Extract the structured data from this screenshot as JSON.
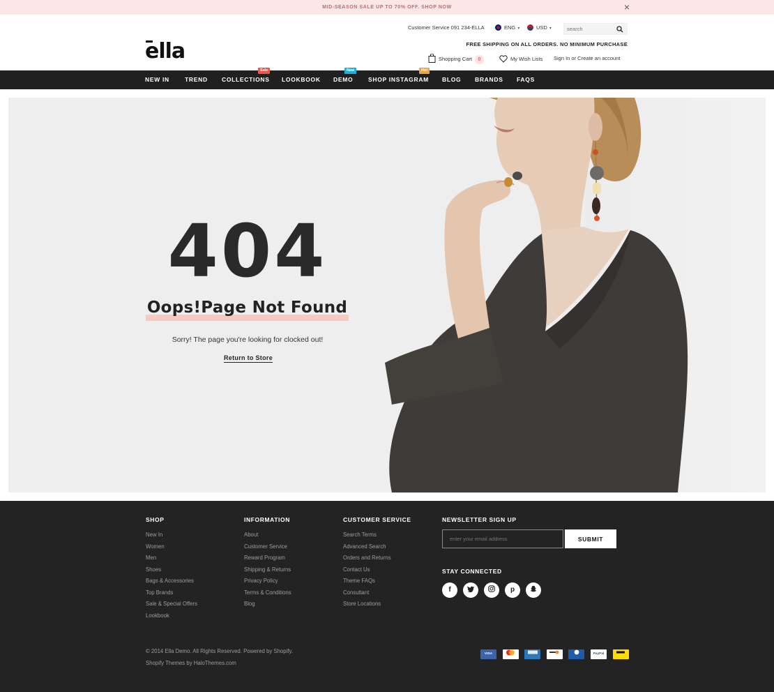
{
  "announcement": {
    "text": "MID-SEASON SALE UP TO 70% OFF. SHOP NOW"
  },
  "header": {
    "logo": "ella",
    "customer_service": "Customer Service 091 234-ELLA",
    "language": "ENG",
    "currency": "USD",
    "search_placeholder": "search",
    "free_shipping": "FREE SHIPPING ON ALL ORDERS. NO MINIMUM PURCHASE",
    "cart_label": "Shopping Cart",
    "cart_count": "0",
    "wishlist_label": "My Wish Lists",
    "signin_label": "Sign In or Create an account"
  },
  "nav": {
    "items": [
      {
        "label": "NEW IN"
      },
      {
        "label": "TREND"
      },
      {
        "label": "COLLECTIONS",
        "badge": "Sale",
        "badge_color": "#e9564a"
      },
      {
        "label": "LOOKBOOK"
      },
      {
        "label": "DEMO",
        "badge": "New",
        "badge_color": "#1fb0d8"
      },
      {
        "label": "SHOP INSTAGRAM",
        "badge": "Hot",
        "badge_color": "#f1a43a"
      },
      {
        "label": "BLOG"
      },
      {
        "label": "BRANDS"
      },
      {
        "label": "FAQS"
      }
    ]
  },
  "hero": {
    "code": "404",
    "title": "Oops!Page Not Found",
    "message": "Sorry! The page you're looking for clocked out!",
    "return_link": "Return to Store",
    "highlight_color": "#f7c9c3"
  },
  "footer": {
    "shop": {
      "heading": "SHOP",
      "links": [
        "New In",
        "Women",
        "Men",
        "Shoes",
        "Bags & Accessories",
        "Top Brands",
        "Sale & Special Offers",
        "Lookbook"
      ]
    },
    "information": {
      "heading": "INFORMATION",
      "links": [
        "About",
        "Customer Service",
        "Reward Program",
        "Shipping & Returns",
        "Privacy Policy",
        "Terms & Conditions",
        "Blog"
      ]
    },
    "customer_service": {
      "heading": "CUSTOMER SERVICE",
      "links": [
        "Search Terms",
        "Advanced Search",
        "Orders and Returns",
        "Contact Us",
        "Theme FAQs",
        "Consultant",
        "Store Locations"
      ]
    },
    "newsletter": {
      "heading": "NEWSLETTER SIGN UP",
      "placeholder": "enter your email address",
      "submit": "SUBMIT",
      "stay_connected": "STAY CONNECTED",
      "socials": [
        "facebook-icon",
        "twitter-icon",
        "instagram-icon",
        "pinterest-icon",
        "snapchat-icon"
      ]
    },
    "copyright": "© 2014 Ella Demo. All Rights Reserved. Powered by Shopify.",
    "credit": "Shopify Themes by HaloThemes.com",
    "payments": [
      {
        "name": "visa-icon",
        "label": "VISA"
      },
      {
        "name": "mastercard-icon",
        "label": ""
      },
      {
        "name": "amex-icon",
        "label": ""
      },
      {
        "name": "discover-icon",
        "label": ""
      },
      {
        "name": "diners-icon",
        "label": ""
      },
      {
        "name": "paypal-icon",
        "label": "PayPal"
      },
      {
        "name": "western-union-icon",
        "label": ""
      }
    ]
  }
}
